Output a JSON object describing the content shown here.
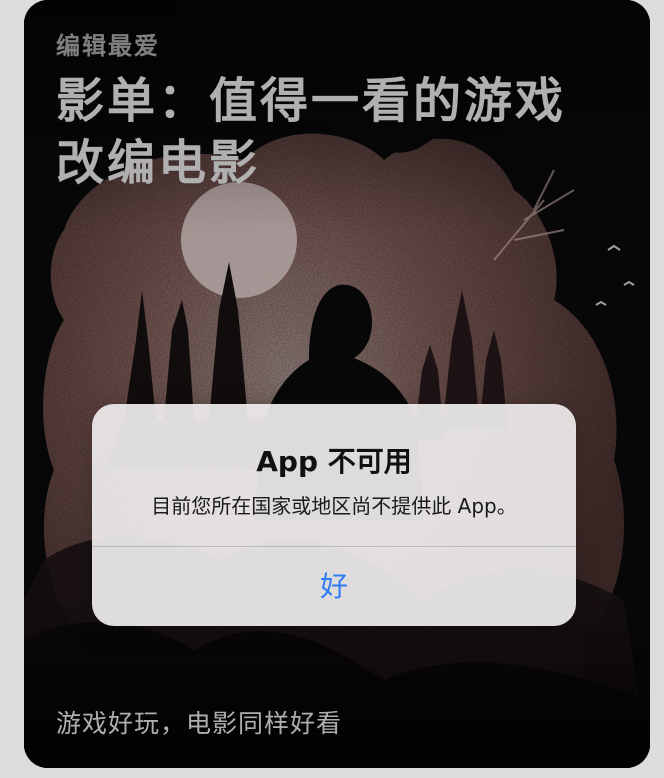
{
  "card": {
    "eyebrow": "编辑最爱",
    "title": "影单：值得一看的游戏改编电影",
    "caption": "游戏好玩，电影同样好看"
  },
  "alert": {
    "title": "App 不可用",
    "message": "目前您所在国家或地区尚不提供此 App。",
    "button_label": "好"
  },
  "colors": {
    "alert_button": "#2f7cf6",
    "card_background": "#070708",
    "art_pink": "#b98b86"
  }
}
